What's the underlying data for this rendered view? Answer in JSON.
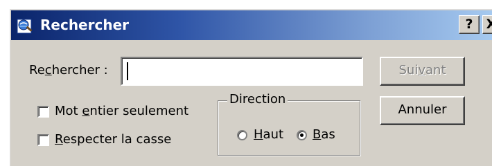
{
  "window": {
    "title": "Rechercher",
    "help_button": "?",
    "close_button": "X"
  },
  "search": {
    "label_prefix": "Re",
    "label_mnemonic": "c",
    "label_suffix": "hercher :",
    "value": ""
  },
  "buttons": {
    "next_prefix": "Sui",
    "next_mnemonic": "v",
    "next_suffix": "ant",
    "next_enabled": false,
    "cancel": "Annuler"
  },
  "options": {
    "whole_word_prefix": "Mot ",
    "whole_word_mnemonic": "e",
    "whole_word_suffix": "ntier seulement",
    "whole_word_checked": false,
    "match_case_mnemonic": "R",
    "match_case_suffix": "especter la casse",
    "match_case_checked": false
  },
  "direction": {
    "legend": "Direction",
    "up_mnemonic": "H",
    "up_suffix": "aut",
    "down_mnemonic": "B",
    "down_suffix": "as",
    "selected": "Bas"
  },
  "colors": {
    "titlebar_start": "#0a246a",
    "titlebar_end": "#a6caf0",
    "face": "#d4d0c8",
    "disabled_text": "#808080"
  },
  "icons": {
    "title": "search-globe-icon"
  }
}
